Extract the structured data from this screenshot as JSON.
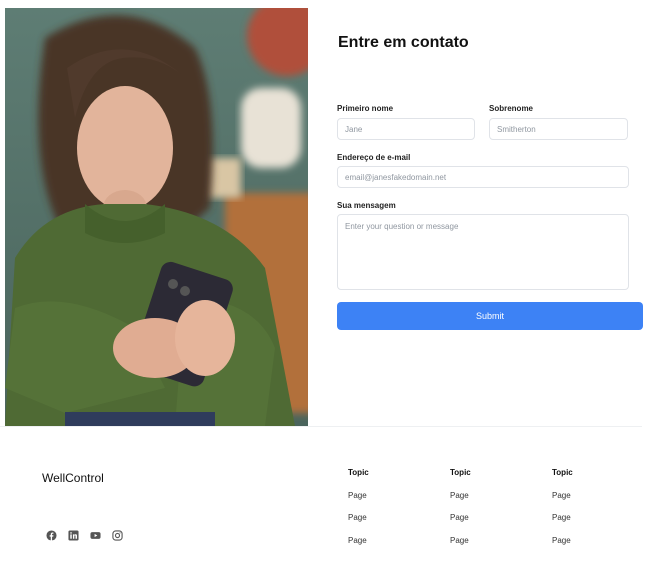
{
  "form": {
    "title": "Entre em contato",
    "first_name": {
      "label": "Primeiro nome",
      "placeholder": "Jane"
    },
    "last_name": {
      "label": "Sobrenome",
      "placeholder": "Smitherton"
    },
    "email": {
      "label": "Endereço de e-mail",
      "placeholder": "email@janesfakedomain.net"
    },
    "message": {
      "label": "Sua mensagem",
      "placeholder": "Enter your question or message"
    },
    "submit_label": "Submit"
  },
  "footer": {
    "brand": "WellControl",
    "social_icons": [
      "facebook-icon",
      "linkedin-icon",
      "youtube-icon",
      "instagram-icon"
    ],
    "columns": [
      {
        "topic": "Topic",
        "pages": [
          "Page",
          "Page",
          "Page"
        ]
      },
      {
        "topic": "Topic",
        "pages": [
          "Page",
          "Page",
          "Page"
        ]
      },
      {
        "topic": "Topic",
        "pages": [
          "Page",
          "Page",
          "Page"
        ]
      }
    ]
  },
  "colors": {
    "accent": "#3d82f5",
    "sweater": "#4f6a34",
    "background_wall": "#5c7a72"
  }
}
